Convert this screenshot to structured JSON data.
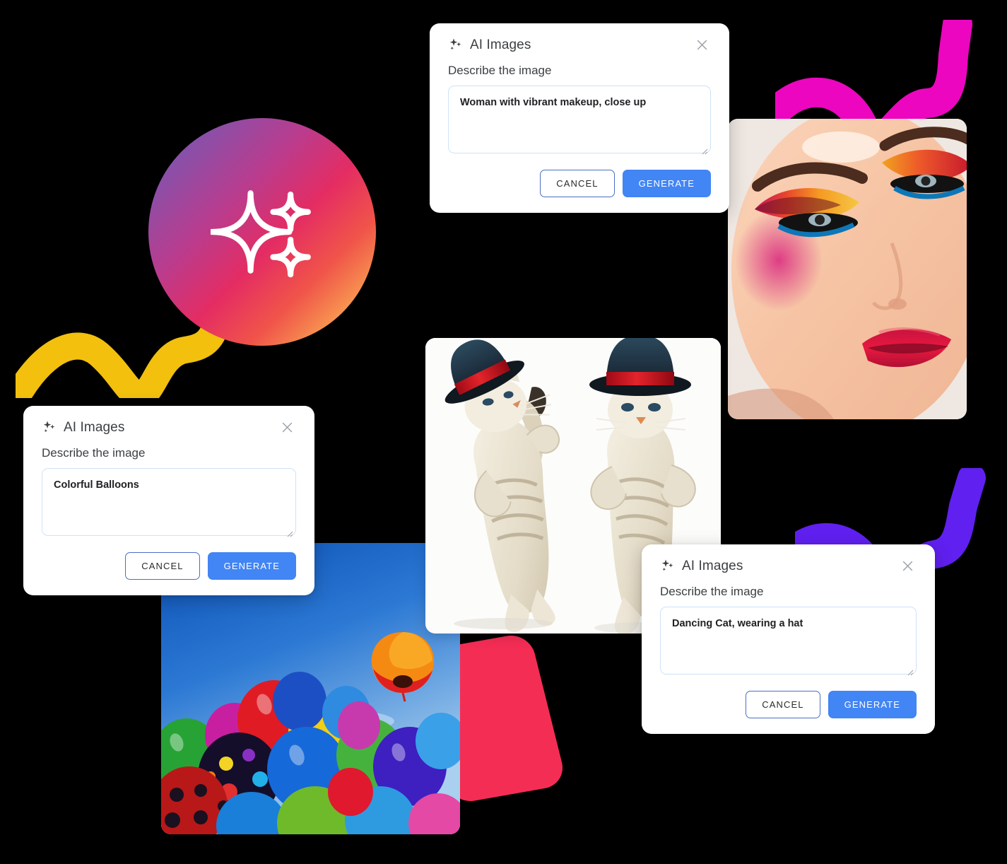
{
  "theme": {
    "accent_blue": "#4285F4",
    "cancel_border": "#4b6fc4",
    "textarea_border": "#cfe2f7",
    "text_primary": "#3c4043",
    "squiggle_yellow": "#F2C00D",
    "squiggle_pink": "#EC06C0",
    "squiggle_purple": "#6020F0",
    "red_shape": "#F42D55",
    "gradient_start": "#6C5DAB",
    "gradient_mid": "#E42C63",
    "gradient_end": "#FBBF5A"
  },
  "icons": {
    "sparkle": "sparkle-icon",
    "close": "close-icon",
    "resize_grip": "resize-grip-icon"
  },
  "dialogs": [
    {
      "id": "face",
      "title": "AI Images",
      "label": "Describe the image",
      "prompt_value": "Woman with vibrant makeup, close up",
      "prompt_placeholder": "Describe the image",
      "cancel_label": "CANCEL",
      "generate_label": "GENERATE"
    },
    {
      "id": "balloons",
      "title": "AI Images",
      "label": "Describe the image",
      "prompt_value": "Colorful Balloons",
      "prompt_placeholder": "Describe the image",
      "cancel_label": "CANCEL",
      "generate_label": "GENERATE"
    },
    {
      "id": "cat",
      "title": "AI Images",
      "label": "Describe the image",
      "prompt_value": "Dancing Cat, wearing a hat",
      "prompt_placeholder": "Describe the image",
      "cancel_label": "CANCEL",
      "generate_label": "GENERATE"
    }
  ],
  "images": [
    {
      "id": "face",
      "alt": "Close-up portrait of a woman with vibrant multicolored eye makeup and red lipstick"
    },
    {
      "id": "cats",
      "alt": "Two dancing cats wearing red-banded top hats on a white background"
    },
    {
      "id": "balloons",
      "alt": "Cluster of colorful balloons floating against a blue sky"
    }
  ],
  "decorations": [
    {
      "id": "gradient-circle",
      "label": "AI sparkle badge"
    },
    {
      "id": "squiggle-yellow",
      "label": "Yellow wavy line"
    },
    {
      "id": "squiggle-pink",
      "label": "Magenta wavy line"
    },
    {
      "id": "squiggle-purple",
      "label": "Purple wavy line"
    },
    {
      "id": "red-shape",
      "label": "Red rounded quadrilateral"
    }
  ]
}
